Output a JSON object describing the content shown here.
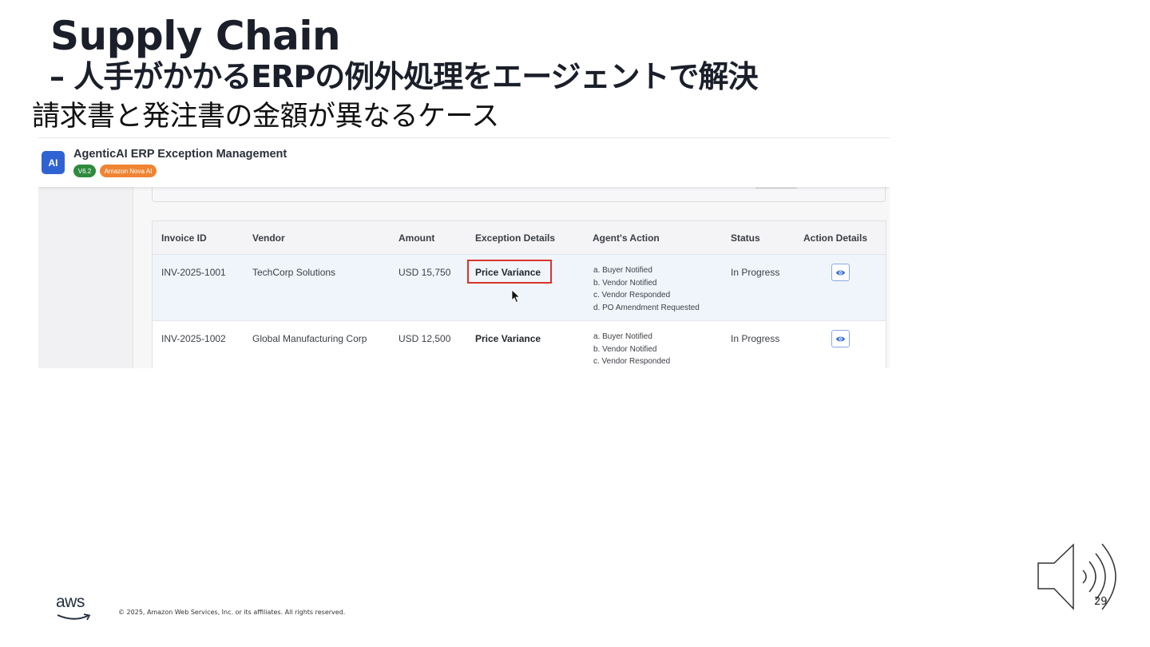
{
  "slide": {
    "title": "Supply Chain",
    "subtitle": "– 人手がかかるERPの例外処理をエージェントで解決",
    "caption": "請求書と発注書の金額が異なるケース",
    "copyright": "© 2025, Amazon Web Services, Inc. or its affiliates. All rights reserved.",
    "page_number": "29",
    "logo_text": "aws"
  },
  "app": {
    "logo_text": "AI",
    "title": "AgenticAI ERP Exception Management",
    "version_badge": "V6.2",
    "model_badge": "Amazon Nova AI",
    "colors": {
      "logo": "#2f63d3",
      "version_badge": "#2e8b3e",
      "model_badge": "#f08432",
      "highlight": "#d9342b",
      "selected_row": "#f0f5fc"
    },
    "table": {
      "columns": [
        "Invoice ID",
        "Vendor",
        "Amount",
        "Exception Details",
        "Agent's Action",
        "Status",
        "Action Details"
      ],
      "rows": [
        {
          "invoice_id": "INV-2025-1001",
          "vendor": "TechCorp Solutions",
          "amount": "USD 15,750",
          "exception": "Price Variance",
          "actions": [
            "a. Buyer Notified",
            "b. Vendor Notified",
            "c. Vendor Responded",
            "d. PO Amendment Requested"
          ],
          "status": "In Progress",
          "action_icon": "eye-icon"
        },
        {
          "invoice_id": "INV-2025-1002",
          "vendor": "Global Manufacturing Corp",
          "amount": "USD 12,500",
          "exception": "Price Variance",
          "actions": [
            "a. Buyer Notified",
            "b. Vendor Notified",
            "c. Vendor Responded"
          ],
          "status": "In Progress",
          "action_icon": "eye-icon"
        }
      ]
    }
  }
}
